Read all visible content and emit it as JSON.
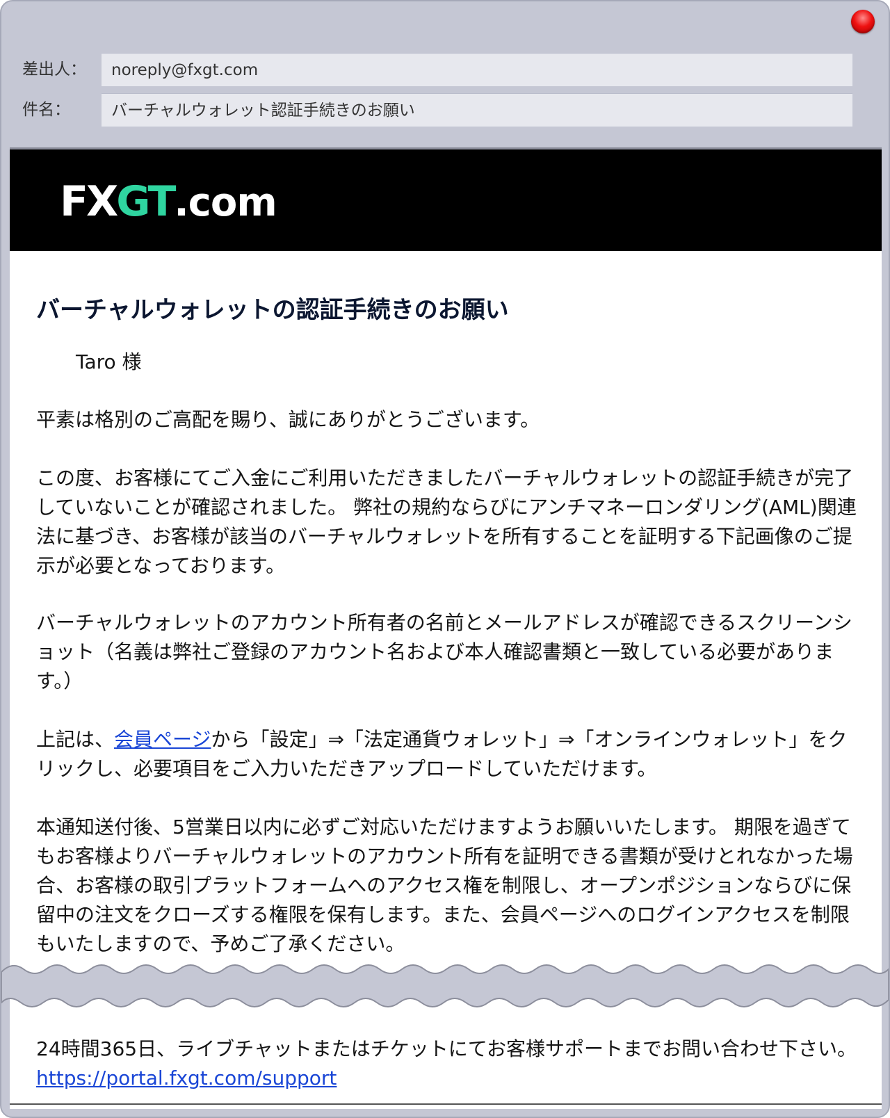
{
  "header": {
    "from_label": "差出人：",
    "from_value": "noreply@fxgt.com",
    "subject_label": "件名：",
    "subject_value": "バーチャルウォレット認証手続きのお願い"
  },
  "brand": {
    "logo_fx": "FX",
    "logo_gt": "GT",
    "logo_com": ".com",
    "accent_color": "#2fd5a0"
  },
  "body": {
    "title": "バーチャルウォレットの認証手続きのお願い",
    "greeting": "Taro 様",
    "p1": "平素は格別のご高配を賜り、誠にありがとうございます。",
    "p2": "この度、お客様にてご入金にご利用いただきましたバーチャルウォレットの認証手続きが完了していないことが確認されました。 弊社の規約ならびにアンチマネーロンダリング(AML)関連法に基づき、お客様が該当のバーチャルウォレットを所有することを証明する下記画像のご提示が必要となっております。",
    "p3": "バーチャルウォレットのアカウント所有者の名前とメールアドレスが確認できるスクリーンショット（名義は弊社ご登録のアカウント名および本人確認書類と一致している必要があります。）",
    "p4_pre": "上記は、",
    "p4_link": "会員ページ",
    "p4_post": "から「設定」⇒「法定通貨ウォレット」⇒「オンラインウォレット」をクリックし、必要項目をご入力いただきアップロードしていただけます。",
    "p5": "本通知送付後、5営業日以内に必ずご対応いただけますようお願いいたします。 期限を過ぎてもお客様よりバーチャルウォレットのアカウント所有を証明できる書類が受けとれなかった場合、お客様の取引プラットフォームへのアクセス権を制限し、オープンポジションならびに保留中の注文をクローズする権限を保有します。また、会員ページへのログインアクセスを制限もいたしますので、予めご了承ください。"
  },
  "footer": {
    "text": "24時間365日、ライブチャットまたはチケットにてお客様サポートまでお問い合わせ下さい。 ",
    "link": "https://portal.fxgt.com/support"
  }
}
